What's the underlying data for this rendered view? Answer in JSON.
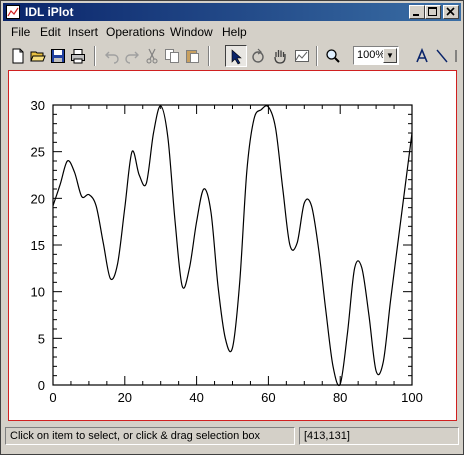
{
  "window": {
    "title": "IDL iPlot"
  },
  "menubar": {
    "items": [
      "File",
      "Edit",
      "Insert",
      "Operations",
      "Window",
      "Help"
    ]
  },
  "toolbar": {
    "zoom_value": "100%"
  },
  "status": {
    "message": "Click on item to select, or click & drag selection box",
    "coords": "[413,131]"
  },
  "colors": {
    "selection_border": "#d02020",
    "title_bar": "#0a246a"
  },
  "chart_data": {
    "type": "line",
    "xlim": [
      0,
      100
    ],
    "ylim": [
      0,
      30
    ],
    "xticks": [
      0,
      20,
      40,
      60,
      80,
      100
    ],
    "yticks": [
      0,
      5,
      10,
      15,
      20,
      25,
      30
    ],
    "series": [
      {
        "x": [
          0,
          2,
          4,
          6,
          8,
          10,
          12,
          14,
          16,
          18,
          20,
          22,
          24,
          26,
          28,
          30,
          32,
          34,
          36,
          38,
          40,
          42,
          44,
          46,
          48,
          50,
          52,
          54,
          56,
          58,
          60,
          62,
          64,
          66,
          68,
          70,
          72,
          74,
          76,
          78,
          80,
          82,
          84,
          86,
          88,
          90,
          92,
          94,
          96,
          98,
          100
        ],
        "y": [
          19.2,
          21.5,
          24.0,
          22.8,
          20.2,
          20.4,
          19.2,
          15.2,
          11.4,
          13.0,
          19.0,
          25.0,
          22.5,
          21.6,
          27.0,
          29.9,
          26.5,
          17.5,
          10.6,
          12.5,
          17.5,
          21.0,
          18.5,
          10.5,
          5.0,
          4.0,
          11.0,
          23.0,
          28.5,
          29.5,
          29.8,
          27.5,
          21.0,
          15.0,
          15.2,
          19.5,
          19.2,
          14.5,
          8.0,
          2.0,
          0.1,
          5.5,
          12.5,
          12.6,
          7.5,
          1.5,
          2.5,
          9.0,
          15.0,
          21.0,
          27.0
        ]
      }
    ]
  }
}
